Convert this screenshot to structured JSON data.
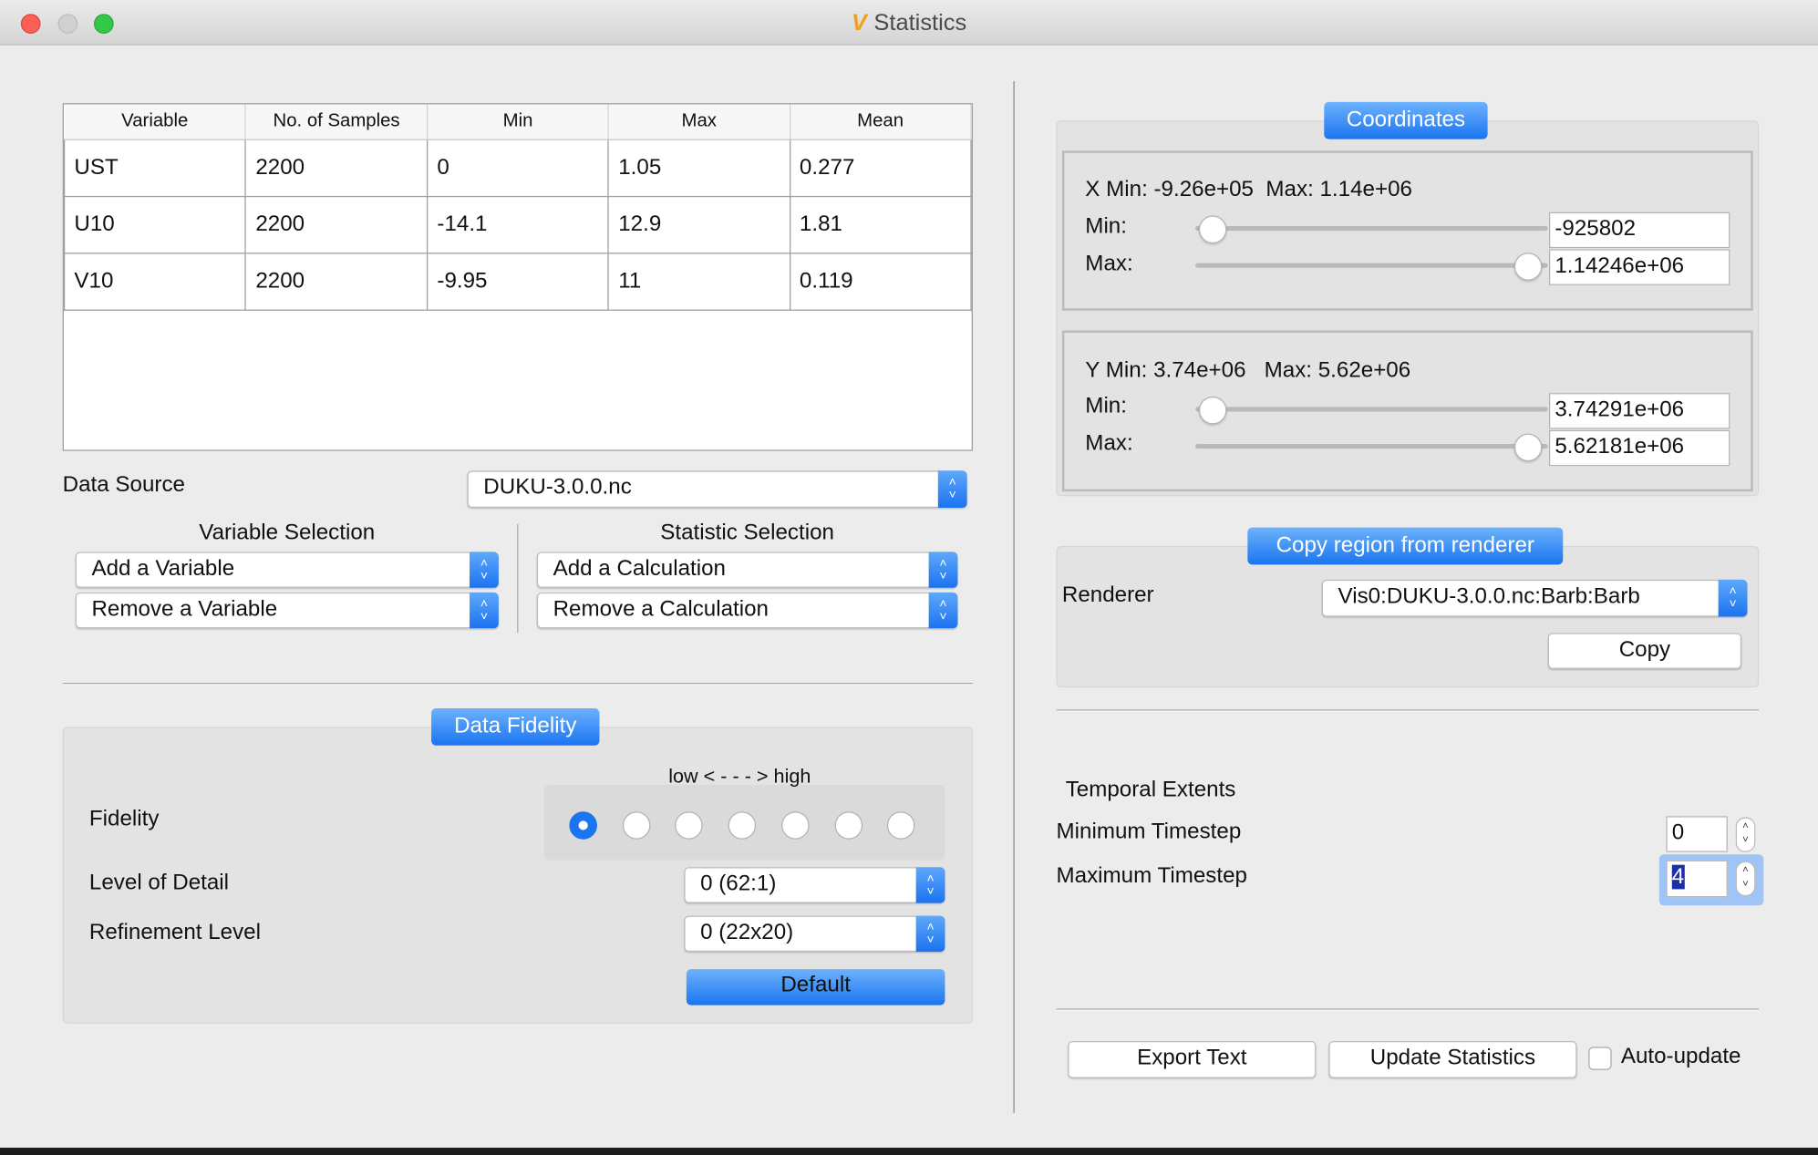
{
  "window": {
    "title": "Statistics",
    "app_icon": "vapor-v-icon"
  },
  "table": {
    "headers": [
      "Variable",
      "No. of Samples",
      "Min",
      "Max",
      "Mean"
    ],
    "rows": [
      [
        "UST",
        "2200",
        "0",
        "1.05",
        "0.277"
      ],
      [
        "U10",
        "2200",
        "-14.1",
        "12.9",
        "1.81"
      ],
      [
        "V10",
        "2200",
        "-9.95",
        "11",
        "0.119"
      ]
    ]
  },
  "data_source": {
    "label": "Data Source",
    "value": "DUKU-3.0.0.nc"
  },
  "variable_selection": {
    "label": "Variable Selection",
    "add": "Add a Variable",
    "remove": "Remove a Variable"
  },
  "statistic_selection": {
    "label": "Statistic Selection",
    "add": "Add a Calculation",
    "remove": "Remove a Calculation"
  },
  "fidelity": {
    "group_title": "Data Fidelity",
    "fidelity_label": "Fidelity",
    "scale_label": "low < - - - > high",
    "options_count": 7,
    "selected_index": 0,
    "lod_label": "Level of Detail",
    "lod_value": "0 (62:1)",
    "refinement_label": "Refinement Level",
    "refinement_value": "0 (22x20)",
    "default_button": "Default"
  },
  "coordinates": {
    "group_title": "Coordinates",
    "x_summary": "X Min: -9.26e+05  Max: 1.14e+06",
    "y_summary": "Y Min: 3.74e+06   Max: 5.62e+06",
    "min_label": "Min:",
    "max_label": "Max:",
    "x_min": "-925802",
    "x_max": "1.14246e+06",
    "y_min": "3.74291e+06",
    "y_max": "5.62181e+06"
  },
  "copy_region": {
    "group_title": "Copy region from renderer",
    "renderer_label": "Renderer",
    "renderer_value": "Vis0:DUKU-3.0.0.nc:Barb:Barb",
    "copy_button": "Copy"
  },
  "temporal": {
    "title": "Temporal Extents",
    "min_label": "Minimum Timestep",
    "min_value": "0",
    "max_label": "Maximum Timestep",
    "max_value": "4"
  },
  "footer": {
    "export": "Export Text",
    "update": "Update Statistics",
    "auto_update": "Auto-update",
    "auto_update_checked": false
  },
  "colors": {
    "accent": "#1b74f0",
    "close": "#fc5f57",
    "minimize": "#d0d0d0",
    "zoom": "#34c84a"
  }
}
